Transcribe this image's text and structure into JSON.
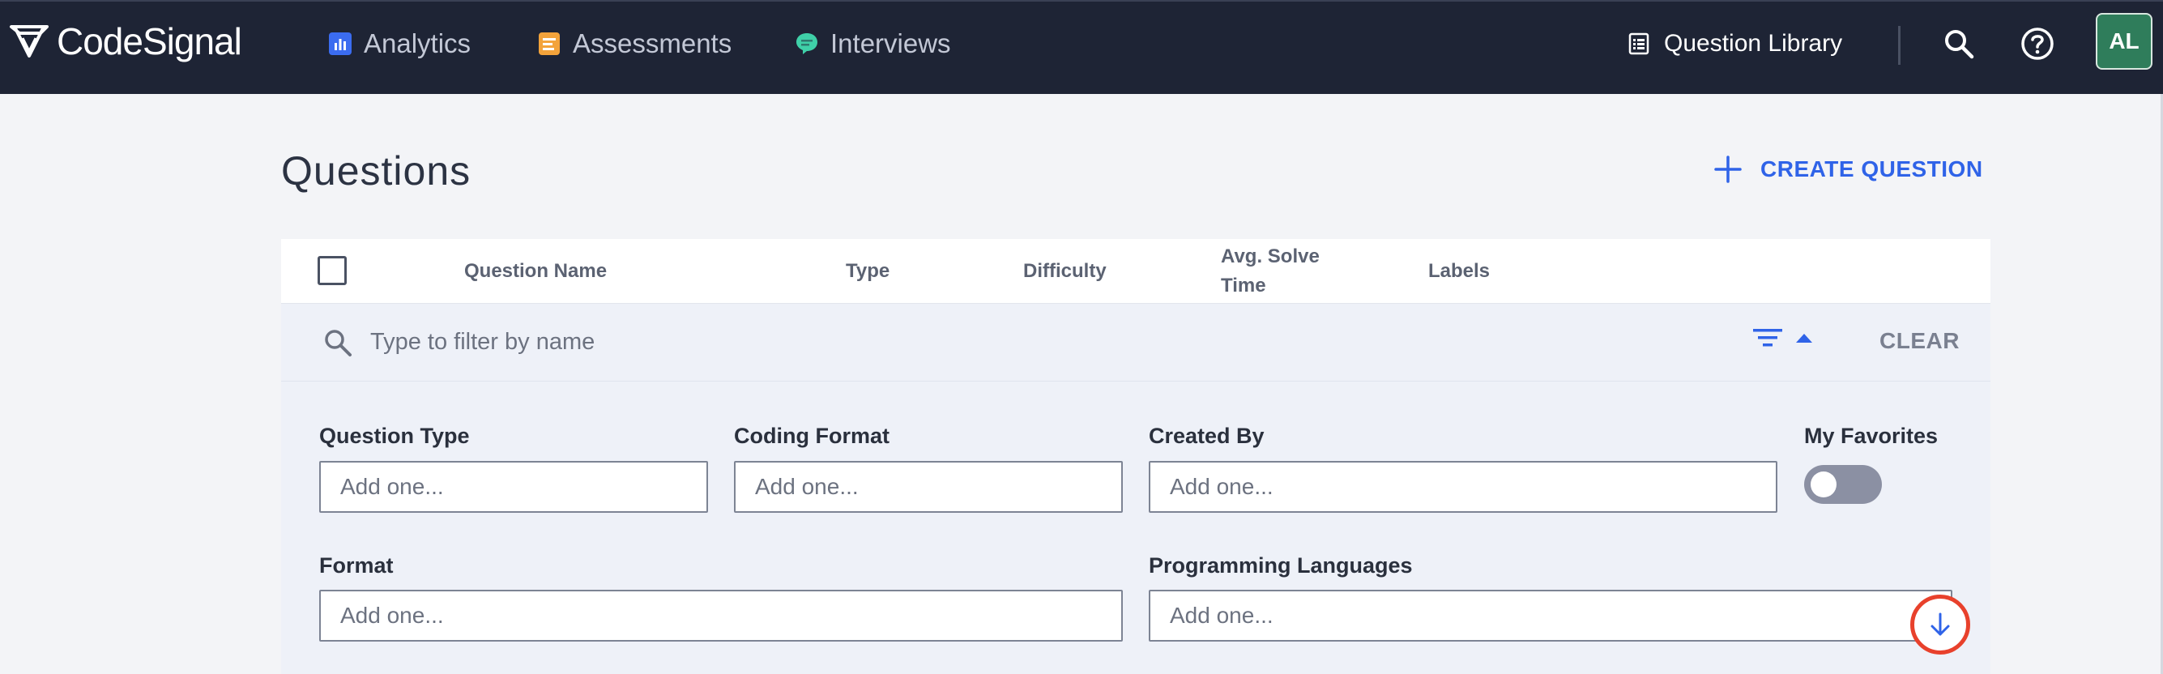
{
  "nav": {
    "logo_text": "CodeSignal",
    "items": [
      {
        "label": "Analytics",
        "icon": "analytics-icon",
        "color": "#3b6cf0"
      },
      {
        "label": "Assessments",
        "icon": "assessments-icon",
        "color": "#f3a33b"
      },
      {
        "label": "Interviews",
        "icon": "interviews-icon",
        "color": "#3fd0a8"
      }
    ],
    "question_library": "Question Library",
    "search_icon": "search-icon",
    "help_icon": "help-icon",
    "avatar_initials": "AL",
    "avatar_color": "#2f7d5b"
  },
  "page": {
    "title": "Questions",
    "create_button": "CREATE QUESTION",
    "accent_color": "#2f63e8"
  },
  "table": {
    "columns": [
      "Question Name",
      "Type",
      "Difficulty",
      "Avg. Solve\nTime",
      "Labels"
    ]
  },
  "filter": {
    "search_placeholder": "Type to filter by name",
    "clear_label": "CLEAR",
    "fields": [
      {
        "label": "Question Type",
        "placeholder": "Add one..."
      },
      {
        "label": "Coding Format",
        "placeholder": "Add one..."
      },
      {
        "label": "Created By",
        "placeholder": "Add one..."
      },
      {
        "label": "Format",
        "placeholder": "Add one..."
      },
      {
        "label": "Programming Languages",
        "placeholder": "Add one..."
      }
    ],
    "favorites_label": "My Favorites",
    "favorites_on": false
  }
}
